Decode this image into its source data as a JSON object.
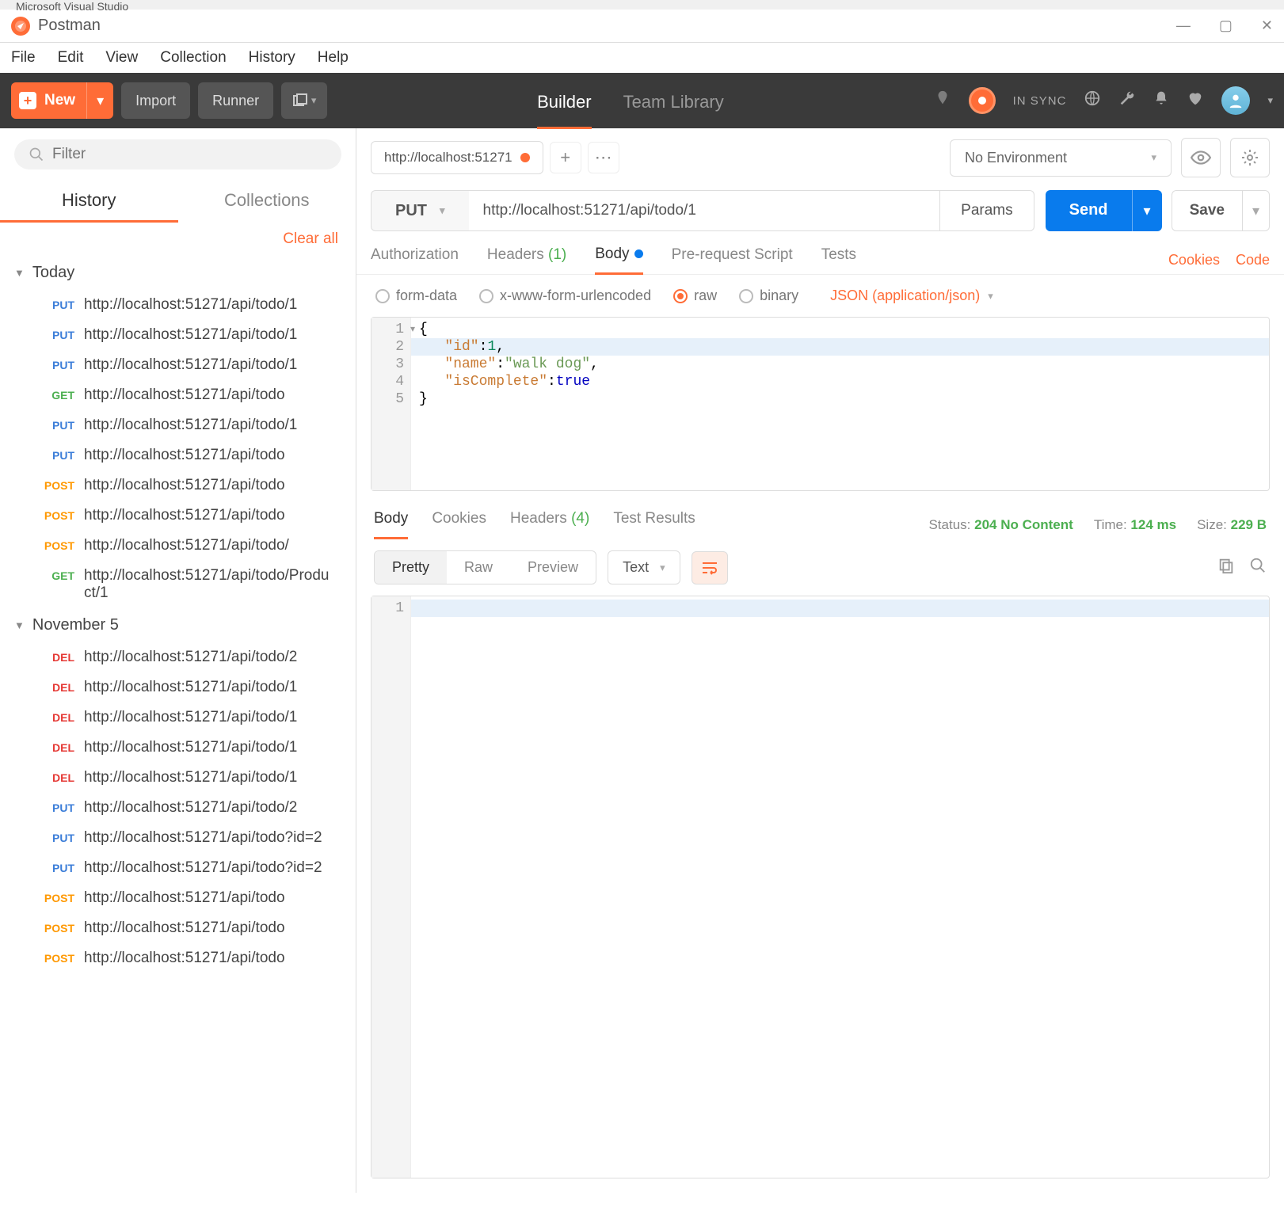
{
  "os": {
    "behind": "Microsoft Visual Studio"
  },
  "window": {
    "title": "Postman",
    "menu": [
      "File",
      "Edit",
      "View",
      "Collection",
      "History",
      "Help"
    ],
    "controls": {
      "min": "—",
      "max": "▢",
      "close": "✕"
    }
  },
  "toolbar": {
    "new": "New",
    "import": "Import",
    "runner": "Runner",
    "tab_builder": "Builder",
    "tab_library": "Team Library",
    "sync": "IN SYNC"
  },
  "sidebar": {
    "filter_placeholder": "Filter",
    "tab_history": "History",
    "tab_collections": "Collections",
    "clear_all": "Clear all",
    "groups": [
      {
        "label": "Today",
        "items": [
          {
            "m": "PUT",
            "u": "http://localhost:51271/api/todo/1"
          },
          {
            "m": "PUT",
            "u": "http://localhost:51271/api/todo/1"
          },
          {
            "m": "PUT",
            "u": "http://localhost:51271/api/todo/1"
          },
          {
            "m": "GET",
            "u": "http://localhost:51271/api/todo"
          },
          {
            "m": "PUT",
            "u": "http://localhost:51271/api/todo/1"
          },
          {
            "m": "PUT",
            "u": "http://localhost:51271/api/todo"
          },
          {
            "m": "POST",
            "u": "http://localhost:51271/api/todo"
          },
          {
            "m": "POST",
            "u": "http://localhost:51271/api/todo"
          },
          {
            "m": "POST",
            "u": "http://localhost:51271/api/todo/"
          },
          {
            "m": "GET",
            "u": "http://localhost:51271/api/todo/Product/1"
          }
        ]
      },
      {
        "label": "November 5",
        "items": [
          {
            "m": "DEL",
            "u": "http://localhost:51271/api/todo/2"
          },
          {
            "m": "DEL",
            "u": "http://localhost:51271/api/todo/1"
          },
          {
            "m": "DEL",
            "u": "http://localhost:51271/api/todo/1"
          },
          {
            "m": "DEL",
            "u": "http://localhost:51271/api/todo/1"
          },
          {
            "m": "DEL",
            "u": "http://localhost:51271/api/todo/1"
          },
          {
            "m": "PUT",
            "u": "http://localhost:51271/api/todo/2"
          },
          {
            "m": "PUT",
            "u": "http://localhost:51271/api/todo?id=2"
          },
          {
            "m": "PUT",
            "u": "http://localhost:51271/api/todo?id=2"
          },
          {
            "m": "POST",
            "u": "http://localhost:51271/api/todo"
          },
          {
            "m": "POST",
            "u": "http://localhost:51271/api/todo"
          },
          {
            "m": "POST",
            "u": "http://localhost:51271/api/todo"
          }
        ]
      }
    ]
  },
  "request": {
    "tab_title": "http://localhost:51271",
    "env_none": "No Environment",
    "method": "PUT",
    "url": "http://localhost:51271/api/todo/1",
    "params": "Params",
    "send": "Send",
    "save": "Save",
    "subtabs": {
      "auth": "Authorization",
      "headers": "Headers",
      "headers_cnt": "(1)",
      "body": "Body",
      "prescript": "Pre-request Script",
      "tests": "Tests",
      "cookies": "Cookies",
      "code": "Code"
    },
    "body_types": {
      "form": "form-data",
      "xwww": "x-www-form-urlencoded",
      "raw": "raw",
      "binary": "binary",
      "ct": "JSON (application/json)"
    },
    "body_lines": [
      "1",
      "2",
      "3",
      "4",
      "5"
    ],
    "body_json": {
      "id": 1,
      "name": "walk dog",
      "isComplete": true
    }
  },
  "response": {
    "tabs": {
      "body": "Body",
      "cookies": "Cookies",
      "headers": "Headers",
      "headers_cnt": "(4)",
      "testres": "Test Results"
    },
    "meta": {
      "status_lbl": "Status:",
      "status_val": "204 No Content",
      "time_lbl": "Time:",
      "time_val": "124 ms",
      "size_lbl": "Size:",
      "size_val": "229 B"
    },
    "view": {
      "pretty": "Pretty",
      "raw": "Raw",
      "preview": "Preview",
      "fmt": "Text"
    },
    "lines": [
      "1"
    ]
  }
}
